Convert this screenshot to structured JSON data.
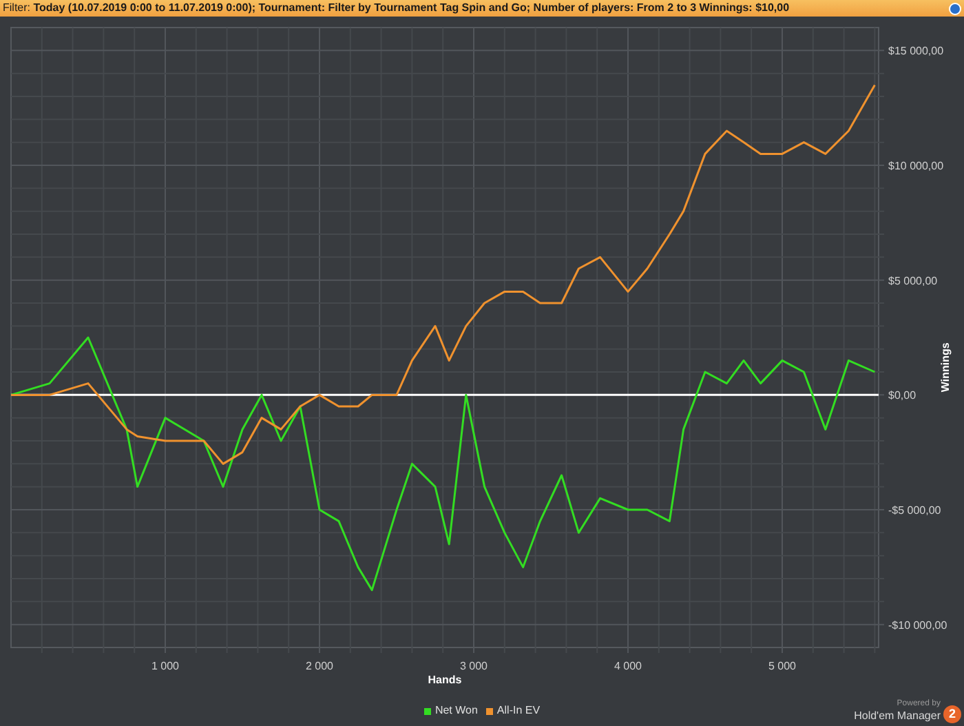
{
  "filter_bar": {
    "text": "Filter: **Today (10.07.2019 0:00 to 11.07.2019 0:00); Tournament: Filter by Tournament Tag  Spin and Go; Number of players: From 2 to 3 Winnings: $10,00**"
  },
  "chart": {
    "chart_data": {
      "type": "line",
      "grid": true,
      "xlabel": "Hands",
      "ylabel": "Winnings",
      "xlim": [
        0,
        5625
      ],
      "ylim": [
        -11000,
        16000
      ],
      "xticks": [
        {
          "value": 1000,
          "label": "1 000"
        },
        {
          "value": 2000,
          "label": "2 000"
        },
        {
          "value": 3000,
          "label": "3 000"
        },
        {
          "value": 4000,
          "label": "4 000"
        },
        {
          "value": 5000,
          "label": "5 000"
        }
      ],
      "yticks": [
        {
          "value": 15000,
          "label": "$15 000,00"
        },
        {
          "value": 10000,
          "label": "$10 000,00"
        },
        {
          "value": 5000,
          "label": "$5 000,00"
        },
        {
          "value": 0,
          "label": "$0,00"
        },
        {
          "value": -5000,
          "label": "-$5 000,00"
        },
        {
          "value": -10000,
          "label": "-$10 000,00"
        }
      ],
      "x": [
        0,
        250,
        500,
        750,
        820,
        1000,
        1250,
        1375,
        1500,
        1625,
        1750,
        1875,
        2000,
        2125,
        2250,
        2340,
        2500,
        2600,
        2750,
        2840,
        2950,
        3070,
        3200,
        3320,
        3430,
        3570,
        3680,
        3820,
        4000,
        4125,
        4270,
        4360,
        4500,
        4640,
        4750,
        4860,
        5000,
        5140,
        5280,
        5430,
        5600
      ],
      "series": [
        {
          "name": "Net Won",
          "color": "#33dd22",
          "values": [
            0,
            500,
            2500,
            -1500,
            -4000,
            -1000,
            -2000,
            -4000,
            -1500,
            0,
            -2000,
            -500,
            -5000,
            -5500,
            -7500,
            -8500,
            -5000,
            -3000,
            -4000,
            -6500,
            0,
            -4000,
            -6000,
            -7500,
            -5500,
            -3500,
            -6000,
            -4500,
            -5000,
            -5000,
            -5500,
            -1500,
            1000,
            500,
            1500,
            500,
            1500,
            1000,
            -1500,
            1500,
            1000
          ]
        },
        {
          "name": "All-In EV",
          "color": "#f0922e",
          "values": [
            0,
            0,
            500,
            -1500,
            -1800,
            -2000,
            -2000,
            -3000,
            -2500,
            -1000,
            -1500,
            -500,
            0,
            -500,
            -500,
            0,
            0,
            1500,
            3000,
            1500,
            3000,
            4000,
            4500,
            4500,
            4000,
            4000,
            5500,
            6000,
            4500,
            5500,
            7000,
            8000,
            10500,
            11500,
            11000,
            10500,
            10500,
            11000,
            10500,
            11500,
            13500
          ]
        }
      ]
    }
  },
  "branding": {
    "caption": "Powered by",
    "product": "Hold'em Manager",
    "badge": "2"
  }
}
